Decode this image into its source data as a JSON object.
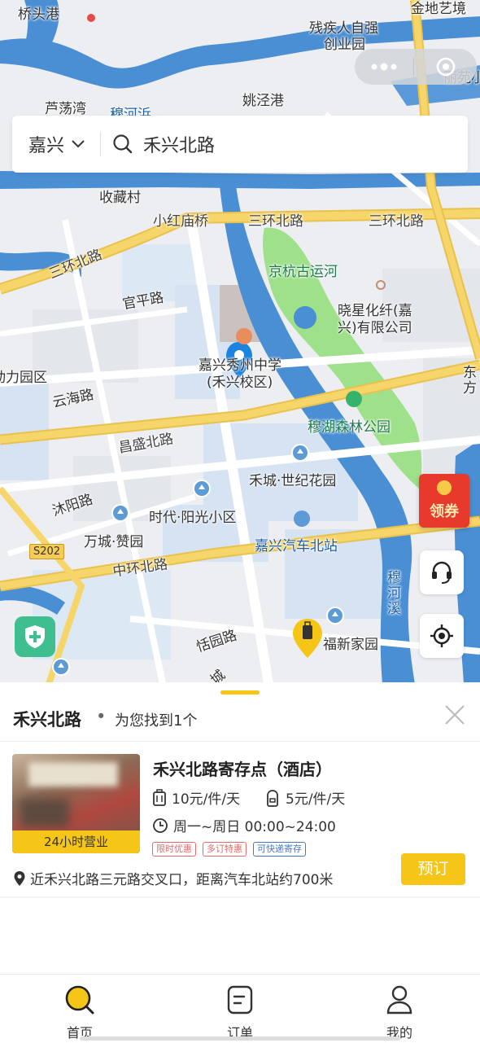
{
  "map": {
    "labels": {
      "qiaotougang": "桥头港",
      "jindi": "金地艺境",
      "canjiren": "残疾人自强",
      "chuangyeyuan": "创业园",
      "lisuyuan": "丽苑小",
      "ludangwan": "芦荡湾",
      "muhebang": "穆河浜",
      "yaojinggang": "姚泾港",
      "shoucangcun": "收藏村",
      "xiaohongmiaoqiao": "小红庙桥",
      "sanhuanbeilu1": "三环北路",
      "sanhuanbeilu2": "三环北路",
      "sanhuanbeilu3": "三环北路",
      "jinghang": "京杭古运河",
      "guanpinglu": "官平路",
      "xiaoxing1": "晓星化纤(嘉",
      "xiaoxing2": "兴)有限公司",
      "school1": "嘉兴秀州中学",
      "school2": "(禾兴校区)",
      "liyuanqu": "动力园区",
      "yunhailu": "云海路",
      "muhusenlin": "穆湖森林公园",
      "dongfang": "东方",
      "changshengbeilu": "昌盛北路",
      "hecheng": "禾城·世纪花园",
      "muyanglu": "沐阳路",
      "shidai": "时代·阳光小区",
      "wancheng": "万城·赞园",
      "jiaxingqichebeizhan": "嘉兴汽车北站",
      "zhonghuanbeilu": "中环北路",
      "muhexi": "穆河溪",
      "tianyuanlu": "恬园路",
      "xinjiayuan": "福新家园",
      "s202": "S202",
      "cheng": "城"
    }
  },
  "search": {
    "city": "嘉兴",
    "query": "禾兴北路"
  },
  "coupon": {
    "label": "领券"
  },
  "results": {
    "road": "禾兴北路",
    "dot": "•",
    "summary": "为您找到1个"
  },
  "store": {
    "name": "禾兴北路寄存点（酒店）",
    "hours_badge": "24小时营业",
    "price_large": "10元/件/天",
    "price_small": "5元/件/天",
    "open_hours": "周一~周日 00:00~24:00",
    "tags": {
      "limited": "限时优惠",
      "multi": "多订特惠",
      "express": "可快递寄存"
    },
    "address": "近禾兴北路三元路交叉口，距离汽车北站约700米",
    "book_label": "预订"
  },
  "tabs": {
    "home": "首页",
    "orders": "订单",
    "mine": "我的"
  },
  "colors": {
    "accent": "#f5c518",
    "water": "#4a8fd4",
    "park": "#9fe08a",
    "road_yellow": "#f6d66a"
  }
}
